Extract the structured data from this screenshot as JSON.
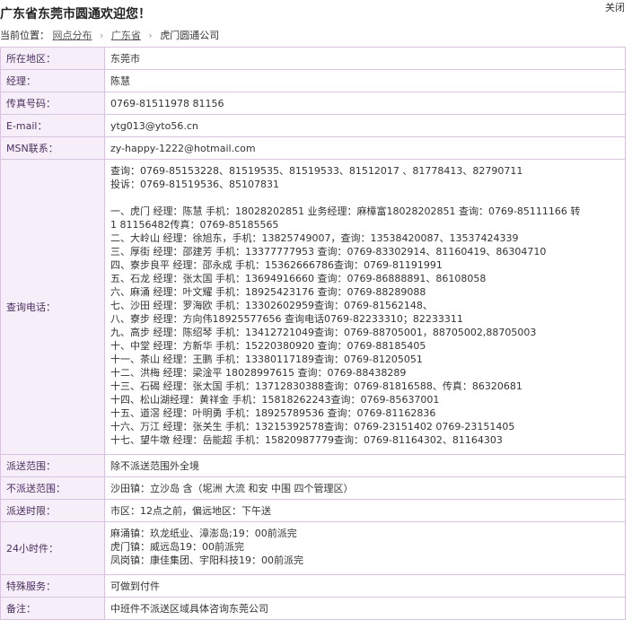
{
  "header": {
    "title": "广东省东莞市圆通欢迎您！",
    "close_label": "关闭"
  },
  "breadcrumb": {
    "prefix": "当前位置：",
    "items": [
      "网点分布",
      "广东省",
      "虎门圆通公司"
    ]
  },
  "rows": {
    "area": {
      "label": "所在地区：",
      "value": "东莞市"
    },
    "manager": {
      "label": "经理：",
      "value": "陈慧"
    },
    "fax": {
      "label": "传真号码：",
      "value": "0769-81511978 81156"
    },
    "email": {
      "label": "E-mail：",
      "value": "ytg013@yto56.cn"
    },
    "msn": {
      "label": "MSN联系：",
      "value": "zy-happy-1222@hotmail.com"
    },
    "phone": {
      "label": "查询电话：",
      "lines": [
        "查询：0769-85153228、81519535、81519533、81512017 、81778413、82790711",
        "投诉：0769-81519536、85107831",
        "",
        "一、虎门 经理：陈慧 手机：18028202851 业务经理：麻樟富18028202851 查询：0769-85111166 转",
        "1 81156482传真：0769-85185565",
        "二、大岭山 经理：徐旭东，手机：13825749007，查询：13538420087、13537424339",
        "三、厚街 经理：邵建芳 手机：13377777953 查询：0769-83302914、81160419、86304710",
        "四、寮步良平 经理：邵永成 手机：15362666786查询：0769-81191991",
        "五、石龙 经理：张太国 手机：13694916660 查询：0769-86888891、86108058",
        "六、麻涌 经理：叶文耀 手机：18925423176 查询：0769-88289088",
        "七、沙田 经理：罗海欧 手机：13302602959查询：0769-81562148、",
        "八、寮步 经理：方向伟18925577656 查询电话0769-82233310；82233311",
        "九、高步 经理：陈绍琴 手机：13412721049查询：0769-88705001，88705002,88705003",
        "十、中堂 经理：方新华 手机：15220380920 查询：0769-88185405",
        "十一、茶山 经理：王鹏 手机：13380117189查询：0769-81205051",
        "十二、洪梅 经理：梁淦平 18028997615 查询：0769-88438289",
        "十三、石碣 经理：张太国 手机：13712830388查询：0769-81816588、传真：86320681",
        "十四、松山湖经理：黄祥金 手机：15818262243查询：0769-85637001",
        "十五、道滘 经理：叶明勇 手机：18925789536 查询：0769-81162836",
        "十六、万江 经理：张关生 手机：13215392578查询：0769-23151402 0769-23151405",
        "十七、望牛墩 经理：岳能超 手机：15820987779查询：0769-81164302、81164303"
      ]
    },
    "delivery_range": {
      "label": "派送范围：",
      "value": "除不派送范围外全境"
    },
    "no_delivery": {
      "label": "不派送范围：",
      "value": "沙田镇：立沙岛 含（坭洲 大流 和安 中围 四个管理区）"
    },
    "delivery_time": {
      "label": "派送时限：",
      "value": "市区：12点之前，偏远地区：下午送"
    },
    "hour24": {
      "label": "24小时件：",
      "lines": [
        "麻涌镇：玖龙纸业、漳澎岛;19：00前派完",
        "虎门镇：威远岛19：00前派完",
        "凤岗镇：康佳集团、宇阳科技19：00前派完"
      ]
    },
    "special": {
      "label": "特殊服务：",
      "value": "可做到付件"
    },
    "remark": {
      "label": "备注：",
      "value": "中班件不派送区域具体咨询东莞公司"
    }
  }
}
